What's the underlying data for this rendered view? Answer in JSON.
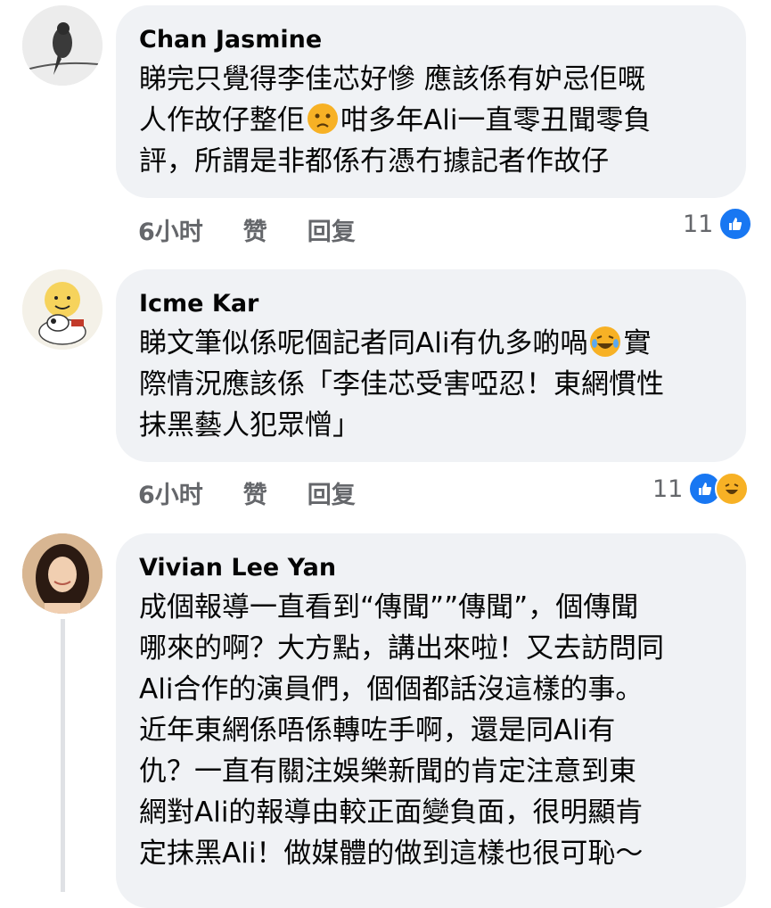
{
  "comments": [
    {
      "author": "Chan Jasmine",
      "lines": [
        "睇完只覺得李佳芯好慘 應該係有妒忌佢嘅",
        "人作故仔整佢",
        "咁多年Ali一直零丑聞零負",
        "評，所謂是非都係冇憑冇據記者作故仔"
      ],
      "time": "6小时",
      "like_label": "赞",
      "reply_label": "回复",
      "reaction_count": "11",
      "emoji_inline": "worried-face"
    },
    {
      "author": "Icme Kar",
      "lines": [
        "睇文筆似係呢個記者同Ali有仇多啲喎",
        "實",
        "際情況應該係「李佳芯受害啞忍！東網慣性",
        "抹黑藝人犯眾憎」"
      ],
      "time": "6小时",
      "like_label": "赞",
      "reply_label": "回复",
      "reaction_count": "11",
      "emoji_inline": "tears-of-joy-face"
    },
    {
      "author": "Vivian Lee Yan",
      "lines": [
        "成個報導一直看到“傳聞””傳聞”，個傳聞",
        "哪來的啊？大方點，講出來啦！又去訪問同",
        "Ali合作的演員們，個個都話沒這樣的事。",
        "近年東網係唔係轉咗手啊，還是同Ali有",
        "仇？一直有關注娛樂新聞的肯定注意到東",
        "網對Ali的報導由較正面變負面，很明顯肯",
        "定抹黑Ali！做媒體的做到這樣也很可恥～"
      ]
    }
  ],
  "colors": {
    "bubble": "#f0f2f5",
    "meta": "#65676b",
    "like": "#1877f2",
    "haha": "#f7b125"
  }
}
